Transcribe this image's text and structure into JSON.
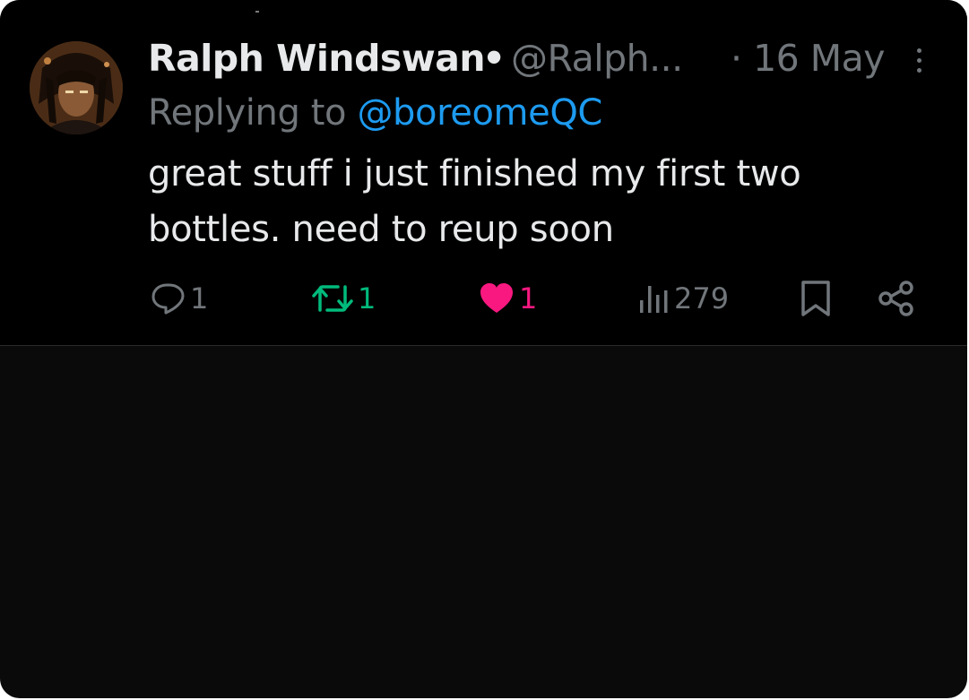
{
  "tweet": {
    "author_name": "Ralph Windswan",
    "separator": "•",
    "handle": "@Ralph...",
    "date": "· 16 May",
    "reply_prefix": "Replying to",
    "reply_handle": "@boreomeQC",
    "text": "great stuff i just finished my first two bottles. need to reup soon",
    "stats": {
      "replies": "1",
      "retweets": "1",
      "likes": "1",
      "views": "279"
    },
    "liked": true,
    "retweeted": true
  },
  "icons": {
    "more": "more-vertical-icon",
    "reply": "comment-bubble-icon",
    "retweet": "retweet-icon",
    "like": "heart-icon",
    "views": "analytics-bars-icon",
    "bookmark": "bookmark-icon",
    "share": "share-icon"
  },
  "colors": {
    "background": "#000000",
    "text": "#e7e9ea",
    "muted": "#71767b",
    "link": "#1d9bf0",
    "retweet": "#00ba7c",
    "like": "#f91880"
  }
}
